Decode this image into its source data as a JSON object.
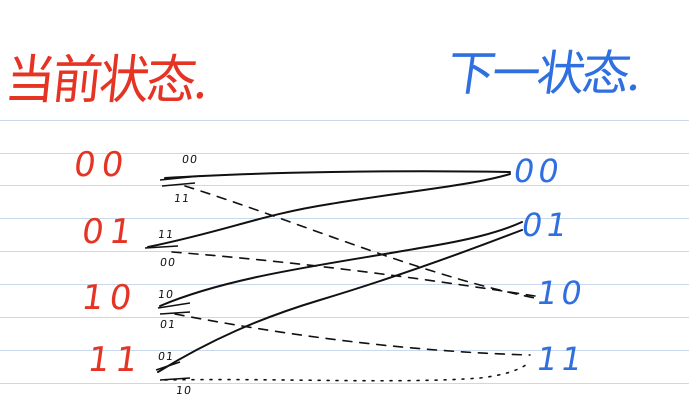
{
  "titles": {
    "current": "当前状态.",
    "next": "下一状态."
  },
  "current_states": [
    "00",
    "01",
    "10",
    "11"
  ],
  "next_states": [
    "00",
    "01",
    "10",
    "11"
  ],
  "edge_labels": {
    "s00_upper": "00",
    "s00_lower": "11",
    "s01_upper": "11",
    "s01_lower": "00",
    "s10_upper": "10",
    "s10_lower": "01",
    "s11_upper": "01",
    "s11_lower": "10"
  },
  "colors": {
    "current": "#e53324",
    "next": "#2f6fe0",
    "ink": "#111111",
    "rule": "#c9d8ea"
  },
  "transitions": [
    {
      "from": "00",
      "to": "00",
      "output": "00",
      "style": "solid"
    },
    {
      "from": "00",
      "to": "10",
      "output": "11",
      "style": "dashed"
    },
    {
      "from": "01",
      "to": "00",
      "output": "11",
      "style": "solid"
    },
    {
      "from": "01",
      "to": "10",
      "output": "00",
      "style": "dashed"
    },
    {
      "from": "10",
      "to": "01",
      "output": "10",
      "style": "solid"
    },
    {
      "from": "10",
      "to": "11",
      "output": "01",
      "style": "dashed"
    },
    {
      "from": "11",
      "to": "01",
      "output": "01",
      "style": "solid"
    },
    {
      "from": "11",
      "to": "11",
      "output": "10",
      "style": "dotted"
    }
  ]
}
